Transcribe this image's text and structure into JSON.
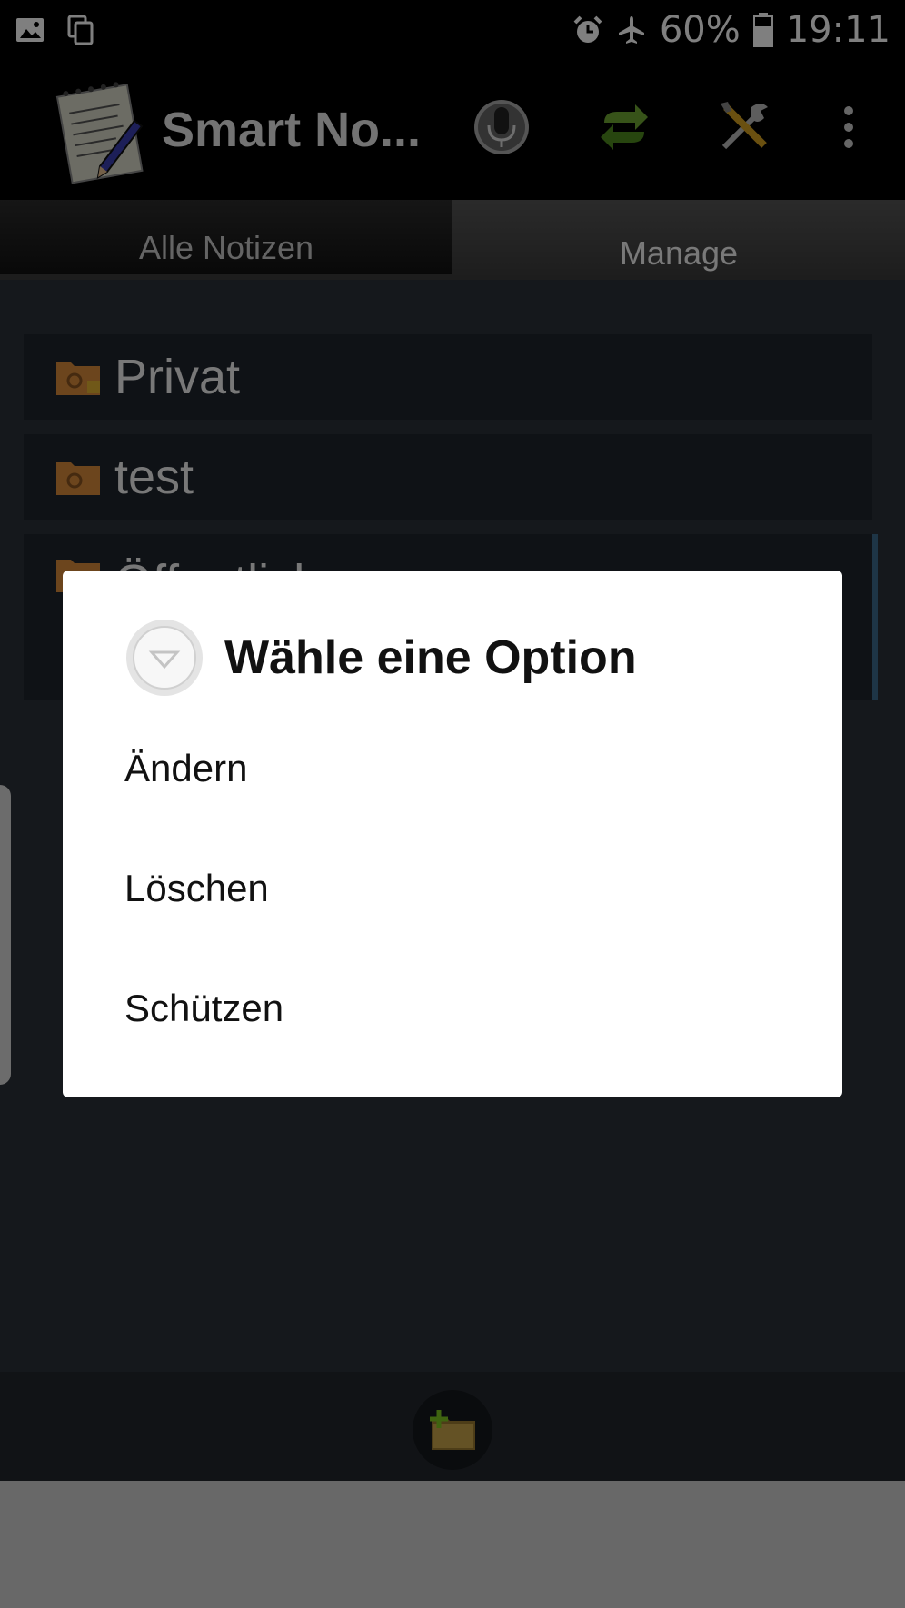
{
  "status_bar": {
    "icons_left": [
      "image-icon",
      "copy-icon"
    ],
    "icons_right": [
      "alarm-icon",
      "airplane-icon"
    ],
    "battery": "60%",
    "time": "19:11"
  },
  "action_bar": {
    "app_title": "Smart No...",
    "buttons": [
      "microphone-icon",
      "sync-icon",
      "tools-icon",
      "overflow-menu-icon"
    ]
  },
  "tabs": [
    {
      "label": "Alle Notizen",
      "active": false
    },
    {
      "label": "Manage",
      "active": true
    }
  ],
  "folders": [
    {
      "label": "Privat",
      "icon": "locked-folder-icon"
    },
    {
      "label": "test",
      "icon": "folder-icon"
    },
    {
      "label": "Öffentlich",
      "icon": "folder-icon"
    }
  ],
  "dialog": {
    "title": "Wähle eine Option",
    "items": [
      "Ändern",
      "Löschen",
      "Schützen"
    ]
  },
  "colors": {
    "content_bg": "#2b3038",
    "row_bg": "#1f242c",
    "dialog_bg": "#ffffff",
    "sync_green": "#6fa632",
    "folder_orange": "#d88a3a"
  }
}
